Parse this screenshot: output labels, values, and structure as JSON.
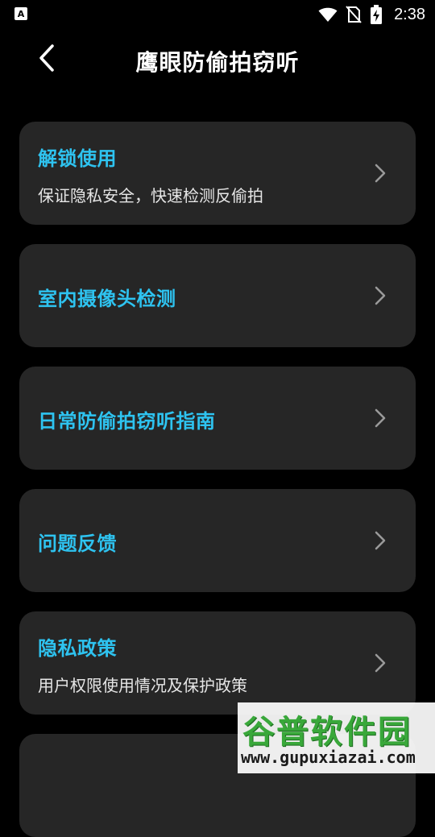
{
  "status_bar": {
    "left_badge": "A",
    "time": "2:38",
    "icons": [
      "wifi-icon",
      "no-sim-icon",
      "battery-charging-icon"
    ]
  },
  "header": {
    "title": "鹰眼防偷拍窃听",
    "back_icon": "chevron-left-icon"
  },
  "menu": {
    "items": [
      {
        "title": "解锁使用",
        "subtitle": "保证隐私安全，快速检测反偷拍"
      },
      {
        "title": "室内摄像头检测",
        "subtitle": ""
      },
      {
        "title": "日常防偷拍窃听指南",
        "subtitle": ""
      },
      {
        "title": "问题反馈",
        "subtitle": ""
      },
      {
        "title": "隐私政策",
        "subtitle": "用户权限使用情况及保护政策"
      },
      {
        "title": "",
        "subtitle": ""
      }
    ]
  },
  "watermark": {
    "brand": "谷普软件园",
    "url": "www.gupuxiazai.com"
  },
  "colors": {
    "background": "#000000",
    "card": "#262626",
    "accent": "#2ec3f0",
    "text": "#ffffff",
    "subtext": "#e6e6e6"
  }
}
